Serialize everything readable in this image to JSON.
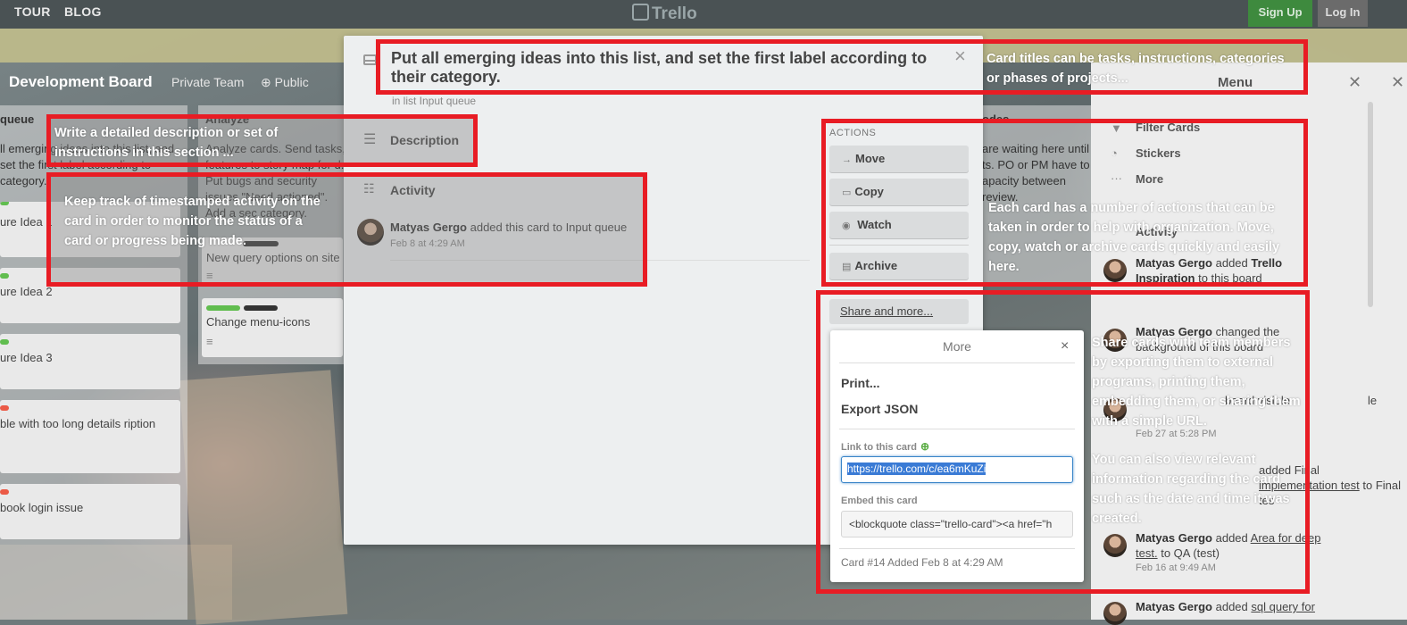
{
  "topbar": {
    "nav": [
      "TOUR",
      "BLOG"
    ],
    "logo": "Trello",
    "signup": "Sign Up",
    "login": "Log In"
  },
  "board": {
    "title": "Development Board",
    "team": "Private Team",
    "visibility": "Public",
    "lists": [
      {
        "name": "queue",
        "desc": "ll emerging ideas into this list, and set the first label according to category.",
        "cards": [
          "ure Idea 1",
          "ure Idea 2",
          "ure Idea 3",
          "ble with too long details ription",
          "book login issue"
        ]
      },
      {
        "name": "Analyze",
        "desc": "Analyze cards. Send tasks, features to story map for d. Put bugs and security issues \"Need actioned\". Add a sec category.",
        "cards": [
          "New query options on site",
          "Change menu-icons"
        ]
      },
      {
        "name": "odes",
        "desc": "are waiting here until ts. PO or PM have to apacity between review."
      }
    ]
  },
  "menu": {
    "title": "Menu",
    "items": [
      "Filter Cards",
      "Stickers",
      "More"
    ],
    "activity_title": "Activity",
    "activity": [
      {
        "user": "Matyas Gergo",
        "action": "added",
        "target": "Trello Inspiration",
        "rest": "to this board"
      },
      {
        "user": "Matyas Gergo",
        "action": "changed the",
        "rest": "background of this board",
        "time": ""
      },
      {
        "user": "",
        "action": "board visible",
        "rest": "le",
        "time": "Feb 27 at 5:28 PM"
      },
      {
        "user": "",
        "action": "added Final",
        "target": "implementation test",
        "rest": "to Final tes",
        "time": ""
      },
      {
        "user": "Matyas Gergo",
        "action": "added",
        "target": "Area for deep test.",
        "rest": "to QA (test)",
        "time": "Feb 16 at 9:49 AM"
      },
      {
        "user": "Matyas Gergo",
        "action": "added",
        "target": "sql query for",
        "rest": ""
      }
    ]
  },
  "modal": {
    "title": "Put all emerging ideas into this list, and set the first label according to their category.",
    "list_ref": "in list Input queue",
    "close": "×",
    "description_title": "Description",
    "activity_title": "Activity",
    "activity_user": "Matyas Gergo",
    "activity_text": "added this card to Input queue",
    "activity_time": "Feb 8 at 4:29 AM",
    "actions_label": "ACTIONS",
    "actions": [
      "Move",
      "Copy",
      "Watch",
      "Archive"
    ],
    "share": "Share and more..."
  },
  "popover": {
    "title": "More",
    "close": "×",
    "items": [
      "Print...",
      "Export JSON"
    ],
    "link_label": "Link to this card",
    "link_value": "https://trello.com/c/ea6mKuZi",
    "embed_label": "Embed this card",
    "embed_value": "<blockquote class=\"trello-card\"><a href=\"h",
    "footer": "Card #14  Added Feb 8 at 4:29 AM"
  },
  "annotations": {
    "title": "Card titles can be tasks, instructions, categories or phases of projects...",
    "description": "Write a detailed description or set of instructions in this section ...",
    "activity": "Keep track of timestamped activity on the card in order to monitor the status of a card or progress being made.",
    "actions": "Each card has a number of actions that can be taken in order to help with organization. Move, copy, watch or archive cards quickly and easily here.",
    "share_1": "Share cards with team members by exporting them to external programs, printing them, embedding them, or sharing them with a simple URL.",
    "share_2": "You can also view relevant information regarding the card such as the date and time it was created."
  },
  "colors": {
    "annotation_red": "#e81c24",
    "label_green": "#61bd4f",
    "label_red": "#eb5a46",
    "link_blue": "#3a85c8"
  }
}
